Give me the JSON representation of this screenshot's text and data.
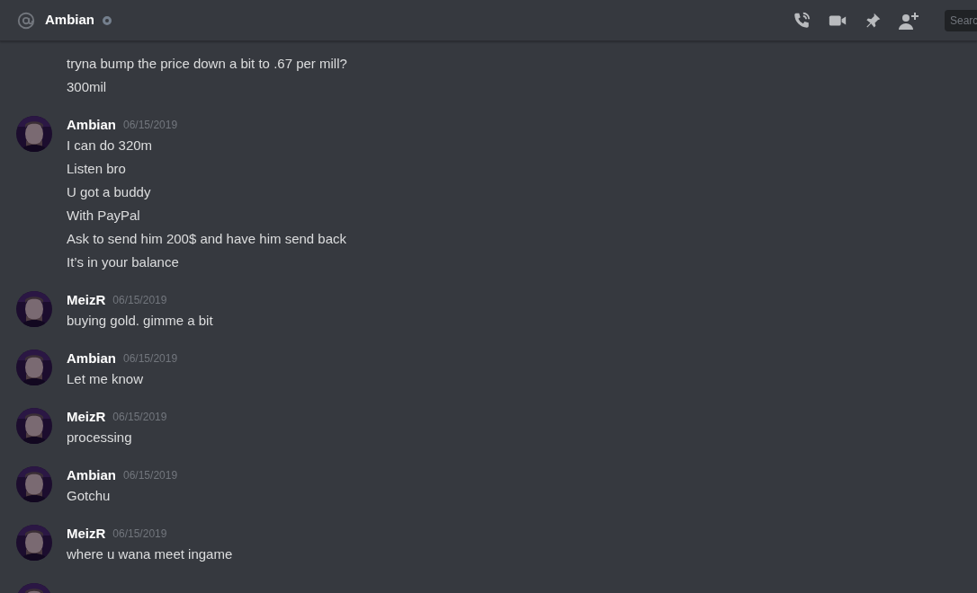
{
  "header": {
    "channel": "Ambian",
    "online": false,
    "search": {
      "placeholder": "Searc"
    }
  },
  "messages": [
    {
      "lines": [
        "tryna bump the price down a bit to .67 per mill?",
        "300mil"
      ]
    },
    {
      "author": "Ambian",
      "avatar": {
        "kind": "picture"
      },
      "timestamp": "06/15/2019",
      "lines": [
        "I can do 320m",
        "Listen bro",
        "U got a buddy",
        "With PayPal",
        "Ask to send him 200$ and have him send back",
        "It’s in your balance"
      ]
    },
    {
      "author": "MeizR",
      "avatar": {
        "kind": "picture"
      },
      "timestamp": "06/15/2019",
      "lines": [
        "buying gold. gimme a bit"
      ]
    },
    {
      "author": "Ambian",
      "avatar": {
        "kind": "picture"
      },
      "timestamp": "06/15/2019",
      "lines": [
        "Let me know"
      ]
    },
    {
      "author": "MeizR",
      "avatar": {
        "kind": "picture"
      },
      "timestamp": "06/15/2019",
      "lines": [
        "processing"
      ]
    },
    {
      "author": "Ambian",
      "avatar": {
        "kind": "picture"
      },
      "timestamp": "06/15/2019",
      "lines": [
        "Gotchu"
      ]
    },
    {
      "author": "MeizR",
      "avatar": {
        "kind": "picture"
      },
      "timestamp": "06/15/2019",
      "lines": [
        "where u wana meet ingame"
      ]
    },
    {
      "avatar": {
        "kind": "picture"
      }
    }
  ]
}
